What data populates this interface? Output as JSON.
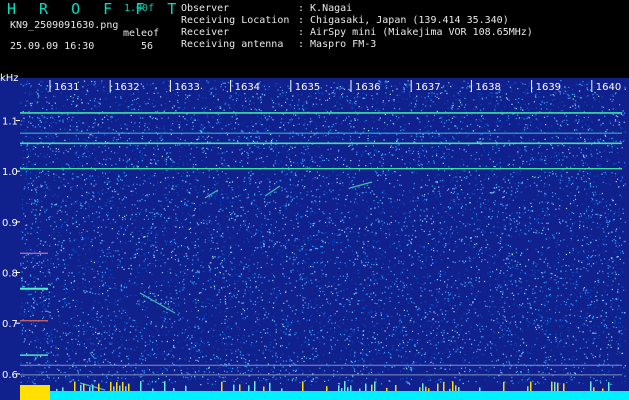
{
  "header": {
    "app_title": "H R O F F T",
    "version": "1.00f",
    "filename": "KN9_2509091630.png",
    "meleof_label": "meleof",
    "datetime": "25.09.09 16:30",
    "meleof_value": "56",
    "fields": [
      {
        "label": "Observer",
        "value": ": K.Nagai"
      },
      {
        "label": "Receiving Location",
        "value": ": Chigasaki, Japan (139.414 35.340)"
      },
      {
        "label": "Receiver",
        "value": ": AirSpy mini (Miakejima VOR 108.65MHz)"
      },
      {
        "label": "Receiving antenna",
        "value": ": Maspro FM-3"
      }
    ]
  },
  "spectrogram": {
    "y_unit": "kHz",
    "y_ticks": [
      "1.1",
      "1.0",
      "0.9",
      "0.8",
      "0.7",
      "0.6"
    ],
    "y_range": [
      0.58,
      1.18
    ],
    "time_ticks": [
      "1631",
      "1632",
      "1633",
      "1634",
      "1635",
      "1636",
      "1637",
      "1638",
      "1639",
      "1640"
    ],
    "colors": {
      "background": "#10208c",
      "noise_light": "#3aa0ff",
      "noise_dense": "#0050d0",
      "line": "#40e0a0",
      "bottom_bar": "#00f0ff",
      "yellow": "#ffe000"
    }
  }
}
